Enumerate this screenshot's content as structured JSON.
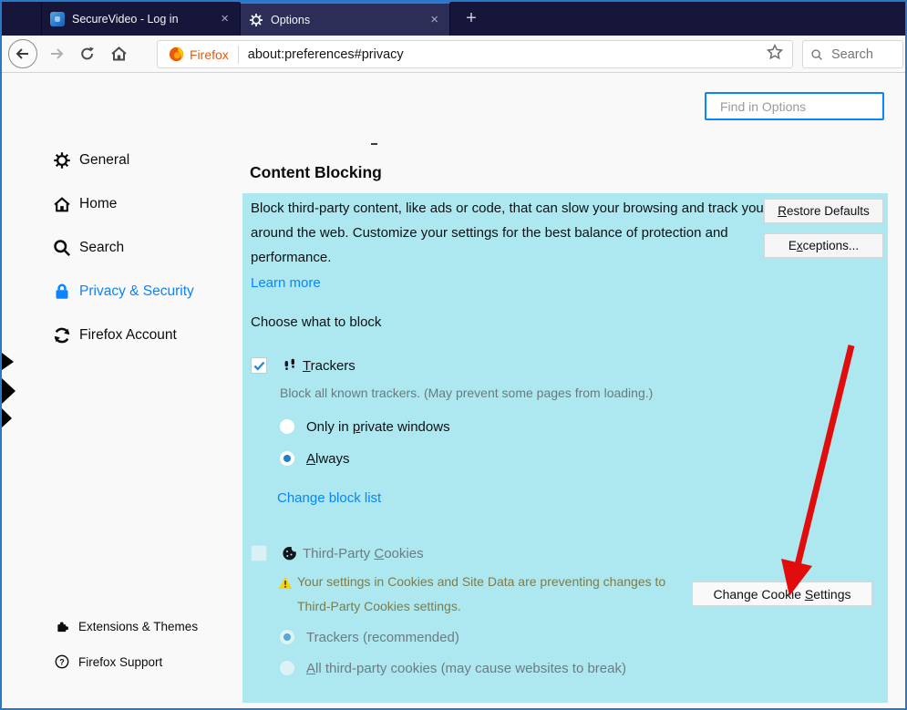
{
  "titlebar": {
    "tabs": [
      {
        "title": "SecureVideo - Log in",
        "close": "×"
      },
      {
        "title": "Options",
        "close": "×"
      }
    ],
    "new_tab_label": "+"
  },
  "navbar": {
    "brand": "Firefox",
    "url": "about:preferences#privacy",
    "search_placeholder": "Search"
  },
  "find": {
    "placeholder": "Find in Options"
  },
  "sidebar": {
    "items": [
      {
        "label": "General"
      },
      {
        "label": "Home"
      },
      {
        "label": "Search"
      },
      {
        "label": "Privacy & Security",
        "active": true
      },
      {
        "label": "Firefox Account"
      }
    ],
    "footer": [
      {
        "label": "Extensions & Themes"
      },
      {
        "label": "Firefox Support"
      }
    ]
  },
  "content": {
    "stray_dash": "-",
    "heading": "Content Blocking",
    "intro": "Block third-party content, like ads or code, that can slow your browsing and track you around the web. Customize your settings for the best balance of protection and performance.",
    "learn_more": "Learn more",
    "restore_defaults": {
      "pre": "",
      "key": "R",
      "post": "estore Defaults"
    },
    "exceptions": {
      "pre": "E",
      "key": "x",
      "post": "ceptions..."
    },
    "choose_label": "Choose what to block",
    "trackers": {
      "label": {
        "pre": "",
        "key": "T",
        "post": "rackers"
      },
      "checked": true,
      "desc": "Block all known trackers. (May prevent some pages from loading.)",
      "radio_private": {
        "pre": "Only in ",
        "key": "p",
        "post": "rivate windows"
      },
      "radio_always": {
        "pre": "",
        "key": "A",
        "post": "lways"
      },
      "selected_radio": "Always",
      "change_block_list": "Change block list"
    },
    "cookies": {
      "label": {
        "pre": "Third-Party ",
        "key": "C",
        "post": "ookies"
      },
      "checked": false,
      "warning_line1": "Your settings in Cookies and Site Data are preventing changes to",
      "warning_line2": "Third-Party Cookies settings.",
      "button": {
        "pre": "Change Cookie ",
        "key": "S",
        "post": "ettings"
      },
      "radio_trackers": "Trackers (recommended)",
      "radio_all": {
        "pre": "",
        "key": "A",
        "post": "ll third-party cookies (may cause websites to break)"
      },
      "selected_radio": "Trackers (recommended)"
    }
  },
  "colors": {
    "accent_blue": "#0a84ff",
    "panel_cyan": "#ade8f0",
    "annotation_arrow_red": "#e10c0c",
    "tabbar_navy": "#15163a",
    "warning_yellow": "#f6d10e"
  }
}
